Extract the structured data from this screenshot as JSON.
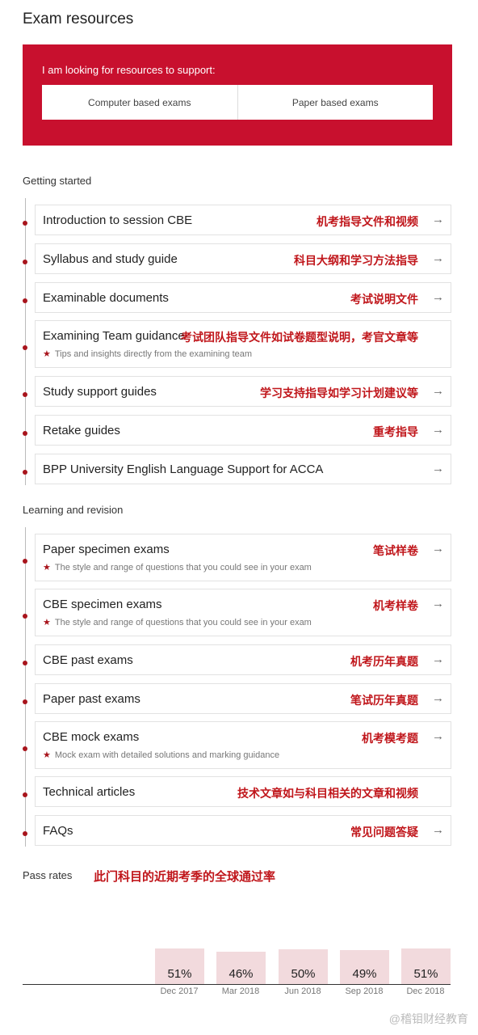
{
  "title": "Exam resources",
  "selector": {
    "label": "I am looking for resources to support:",
    "options": [
      "Computer based exams",
      "Paper based exams"
    ]
  },
  "getting_started": {
    "heading": "Getting started",
    "items": [
      {
        "title": "Introduction to session CBE",
        "note": "机考指导文件和视频"
      },
      {
        "title": "Syllabus and study guide",
        "note": "科目大纲和学习方法指导"
      },
      {
        "title": "Examinable documents",
        "note": "考试说明文件"
      },
      {
        "title": "Examining Team guidance",
        "note": "考试团队指导文件如试卷题型说明，考官文章等",
        "sub": "Tips and insights directly from the examining team"
      },
      {
        "title": "Study support guides",
        "note": "学习支持指导如学习计划建议等"
      },
      {
        "title": "Retake guides",
        "note": "重考指导"
      },
      {
        "title": "BPP University English Language Support for ACCA",
        "note": ""
      }
    ]
  },
  "learning": {
    "heading": "Learning and revision",
    "items": [
      {
        "title": "Paper specimen exams",
        "note": "笔试样卷",
        "sub": "The style and range of questions that you could see in your exam"
      },
      {
        "title": "CBE specimen exams",
        "note": "机考样卷",
        "sub": "The style and range of questions that you could see in your exam"
      },
      {
        "title": "CBE past exams",
        "note": "机考历年真题"
      },
      {
        "title": "Paper past exams",
        "note": "笔试历年真题"
      },
      {
        "title": "CBE mock exams",
        "note": "机考模考题",
        "sub": "Mock exam with detailed solutions and marking guidance"
      },
      {
        "title": "Technical articles",
        "note": "技术文章如与科目相关的文章和视频"
      },
      {
        "title": "FAQs",
        "note": "常见问题答疑"
      }
    ]
  },
  "pass_rates": {
    "heading": "Pass rates",
    "note": "此门科目的近期考季的全球通过率"
  },
  "chart_data": {
    "type": "bar",
    "categories": [
      "Dec 2017",
      "Mar 2018",
      "Jun 2018",
      "Sep 2018",
      "Dec 2018"
    ],
    "values": [
      51,
      46,
      50,
      49,
      51
    ],
    "labels": [
      "51%",
      "46%",
      "50%",
      "49%",
      "51%"
    ],
    "bar_color": "#f2dadd"
  },
  "accent": "#c8102e",
  "watermark": "@稽钼财经教育"
}
